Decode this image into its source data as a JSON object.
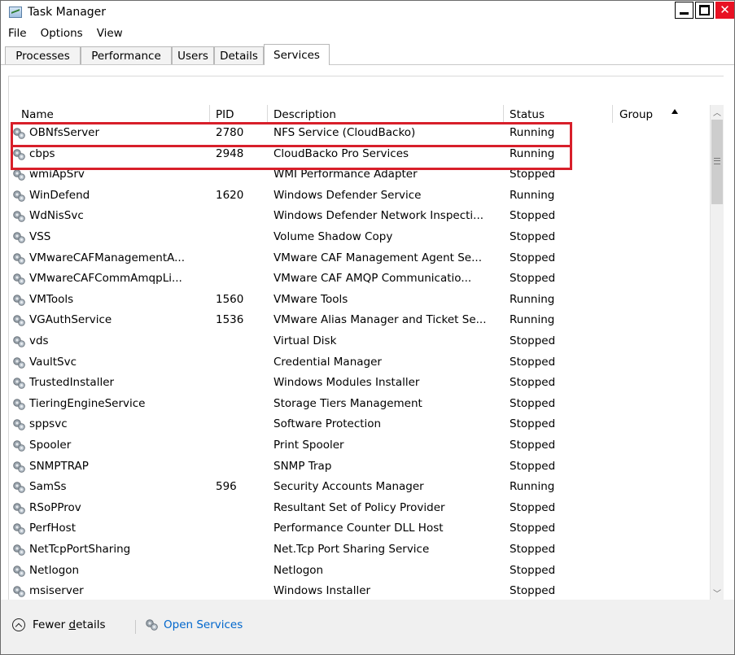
{
  "window": {
    "title": "Task Manager",
    "controls": {
      "minimize": "_",
      "maximize": "□",
      "close": "✕"
    }
  },
  "menu": [
    "File",
    "Options",
    "View"
  ],
  "tabs": [
    "Processes",
    "Performance",
    "Users",
    "Details",
    "Services"
  ],
  "active_tab": "Services",
  "columns": {
    "name": "Name",
    "pid": "PID",
    "description": "Description",
    "status": "Status",
    "group": "Group"
  },
  "sort": {
    "column": "group",
    "direction": "ascending"
  },
  "services": [
    {
      "name": "OBNfsServer",
      "pid": "2780",
      "description": "NFS Service (CloudBacko)",
      "status": "Running"
    },
    {
      "name": "cbps",
      "pid": "2948",
      "description": "CloudBacko Pro Services",
      "status": "Running"
    },
    {
      "name": "wmiApSrv",
      "pid": "",
      "description": "WMI Performance Adapter",
      "status": "Stopped"
    },
    {
      "name": "WinDefend",
      "pid": "1620",
      "description": "Windows Defender Service",
      "status": "Running"
    },
    {
      "name": "WdNisSvc",
      "pid": "",
      "description": "Windows Defender Network Inspecti...",
      "status": "Stopped"
    },
    {
      "name": "VSS",
      "pid": "",
      "description": "Volume Shadow Copy",
      "status": "Stopped"
    },
    {
      "name": "VMwareCAFManagementA...",
      "pid": "",
      "description": "VMware CAF Management Agent Se...",
      "status": "Stopped"
    },
    {
      "name": "VMwareCAFCommAmqpLi...",
      "pid": "",
      "description": "VMware CAF AMQP Communicatio...",
      "status": "Stopped"
    },
    {
      "name": "VMTools",
      "pid": "1560",
      "description": "VMware Tools",
      "status": "Running"
    },
    {
      "name": "VGAuthService",
      "pid": "1536",
      "description": "VMware Alias Manager and Ticket Se...",
      "status": "Running"
    },
    {
      "name": "vds",
      "pid": "",
      "description": "Virtual Disk",
      "status": "Stopped"
    },
    {
      "name": "VaultSvc",
      "pid": "",
      "description": "Credential Manager",
      "status": "Stopped"
    },
    {
      "name": "TrustedInstaller",
      "pid": "",
      "description": "Windows Modules Installer",
      "status": "Stopped"
    },
    {
      "name": "TieringEngineService",
      "pid": "",
      "description": "Storage Tiers Management",
      "status": "Stopped"
    },
    {
      "name": "sppsvc",
      "pid": "",
      "description": "Software Protection",
      "status": "Stopped"
    },
    {
      "name": "Spooler",
      "pid": "",
      "description": "Print Spooler",
      "status": "Stopped"
    },
    {
      "name": "SNMPTRAP",
      "pid": "",
      "description": "SNMP Trap",
      "status": "Stopped"
    },
    {
      "name": "SamSs",
      "pid": "596",
      "description": "Security Accounts Manager",
      "status": "Running"
    },
    {
      "name": "RSoPProv",
      "pid": "",
      "description": "Resultant Set of Policy Provider",
      "status": "Stopped"
    },
    {
      "name": "PerfHost",
      "pid": "",
      "description": "Performance Counter DLL Host",
      "status": "Stopped"
    },
    {
      "name": "NetTcpPortSharing",
      "pid": "",
      "description": "Net.Tcp Port Sharing Service",
      "status": "Stopped"
    },
    {
      "name": "Netlogon",
      "pid": "",
      "description": "Netlogon",
      "status": "Stopped"
    },
    {
      "name": "msiserver",
      "pid": "",
      "description": "Windows Installer",
      "status": "Stopped"
    }
  ],
  "highlighted_services": [
    "OBNfsServer",
    "cbps"
  ],
  "footer": {
    "fewer_details_pre": "Fewer ",
    "fewer_details_underlined": "d",
    "fewer_details_post": "etails",
    "open_services": "Open Services"
  },
  "colors": {
    "highlight_border": "#d81f2a",
    "link": "#0066cc",
    "close_button": "#e81123"
  }
}
